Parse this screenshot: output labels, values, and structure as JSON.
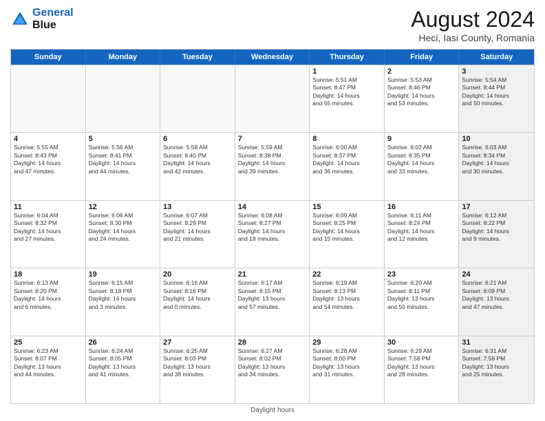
{
  "header": {
    "logo_line1": "General",
    "logo_line2": "Blue",
    "main_title": "August 2024",
    "subtitle": "Heci, Iasi County, Romania"
  },
  "weekdays": [
    "Sunday",
    "Monday",
    "Tuesday",
    "Wednesday",
    "Thursday",
    "Friday",
    "Saturday"
  ],
  "rows": [
    [
      {
        "num": "",
        "info": "",
        "empty": true
      },
      {
        "num": "",
        "info": "",
        "empty": true
      },
      {
        "num": "",
        "info": "",
        "empty": true
      },
      {
        "num": "",
        "info": "",
        "empty": true
      },
      {
        "num": "1",
        "info": "Sunrise: 5:51 AM\nSunset: 8:47 PM\nDaylight: 14 hours\nand 55 minutes."
      },
      {
        "num": "2",
        "info": "Sunrise: 5:53 AM\nSunset: 8:46 PM\nDaylight: 14 hours\nand 53 minutes."
      },
      {
        "num": "3",
        "info": "Sunrise: 5:54 AM\nSunset: 8:44 PM\nDaylight: 14 hours\nand 50 minutes.",
        "shaded": true
      }
    ],
    [
      {
        "num": "4",
        "info": "Sunrise: 5:55 AM\nSunset: 8:43 PM\nDaylight: 14 hours\nand 47 minutes."
      },
      {
        "num": "5",
        "info": "Sunrise: 5:56 AM\nSunset: 8:41 PM\nDaylight: 14 hours\nand 44 minutes."
      },
      {
        "num": "6",
        "info": "Sunrise: 5:58 AM\nSunset: 8:40 PM\nDaylight: 14 hours\nand 42 minutes."
      },
      {
        "num": "7",
        "info": "Sunrise: 5:59 AM\nSunset: 8:38 PM\nDaylight: 14 hours\nand 39 minutes."
      },
      {
        "num": "8",
        "info": "Sunrise: 6:00 AM\nSunset: 8:37 PM\nDaylight: 14 hours\nand 36 minutes."
      },
      {
        "num": "9",
        "info": "Sunrise: 6:02 AM\nSunset: 8:35 PM\nDaylight: 14 hours\nand 33 minutes."
      },
      {
        "num": "10",
        "info": "Sunrise: 6:03 AM\nSunset: 8:34 PM\nDaylight: 14 hours\nand 30 minutes.",
        "shaded": true
      }
    ],
    [
      {
        "num": "11",
        "info": "Sunrise: 6:04 AM\nSunset: 8:32 PM\nDaylight: 14 hours\nand 27 minutes."
      },
      {
        "num": "12",
        "info": "Sunrise: 6:06 AM\nSunset: 8:30 PM\nDaylight: 14 hours\nand 24 minutes."
      },
      {
        "num": "13",
        "info": "Sunrise: 6:07 AM\nSunset: 8:29 PM\nDaylight: 14 hours\nand 21 minutes."
      },
      {
        "num": "14",
        "info": "Sunrise: 6:08 AM\nSunset: 8:27 PM\nDaylight: 14 hours\nand 18 minutes."
      },
      {
        "num": "15",
        "info": "Sunrise: 6:09 AM\nSunset: 8:25 PM\nDaylight: 14 hours\nand 15 minutes."
      },
      {
        "num": "16",
        "info": "Sunrise: 6:11 AM\nSunset: 8:24 PM\nDaylight: 14 hours\nand 12 minutes."
      },
      {
        "num": "17",
        "info": "Sunrise: 6:12 AM\nSunset: 8:22 PM\nDaylight: 14 hours\nand 9 minutes.",
        "shaded": true
      }
    ],
    [
      {
        "num": "18",
        "info": "Sunrise: 6:13 AM\nSunset: 8:20 PM\nDaylight: 14 hours\nand 6 minutes."
      },
      {
        "num": "19",
        "info": "Sunrise: 6:15 AM\nSunset: 8:18 PM\nDaylight: 14 hours\nand 3 minutes."
      },
      {
        "num": "20",
        "info": "Sunrise: 6:16 AM\nSunset: 8:16 PM\nDaylight: 14 hours\nand 0 minutes."
      },
      {
        "num": "21",
        "info": "Sunrise: 6:17 AM\nSunset: 8:15 PM\nDaylight: 13 hours\nand 57 minutes."
      },
      {
        "num": "22",
        "info": "Sunrise: 6:19 AM\nSunset: 8:13 PM\nDaylight: 13 hours\nand 54 minutes."
      },
      {
        "num": "23",
        "info": "Sunrise: 6:20 AM\nSunset: 8:11 PM\nDaylight: 13 hours\nand 50 minutes."
      },
      {
        "num": "24",
        "info": "Sunrise: 6:21 AM\nSunset: 8:09 PM\nDaylight: 13 hours\nand 47 minutes.",
        "shaded": true
      }
    ],
    [
      {
        "num": "25",
        "info": "Sunrise: 6:23 AM\nSunset: 8:07 PM\nDaylight: 13 hours\nand 44 minutes."
      },
      {
        "num": "26",
        "info": "Sunrise: 6:24 AM\nSunset: 8:05 PM\nDaylight: 13 hours\nand 41 minutes."
      },
      {
        "num": "27",
        "info": "Sunrise: 6:25 AM\nSunset: 8:03 PM\nDaylight: 13 hours\nand 38 minutes."
      },
      {
        "num": "28",
        "info": "Sunrise: 6:27 AM\nSunset: 8:02 PM\nDaylight: 13 hours\nand 34 minutes."
      },
      {
        "num": "29",
        "info": "Sunrise: 6:28 AM\nSunset: 8:00 PM\nDaylight: 13 hours\nand 31 minutes."
      },
      {
        "num": "30",
        "info": "Sunrise: 6:29 AM\nSunset: 7:58 PM\nDaylight: 13 hours\nand 28 minutes."
      },
      {
        "num": "31",
        "info": "Sunrise: 6:31 AM\nSunset: 7:56 PM\nDaylight: 13 hours\nand 25 minutes.",
        "shaded": true
      }
    ]
  ],
  "footer": "Daylight hours"
}
